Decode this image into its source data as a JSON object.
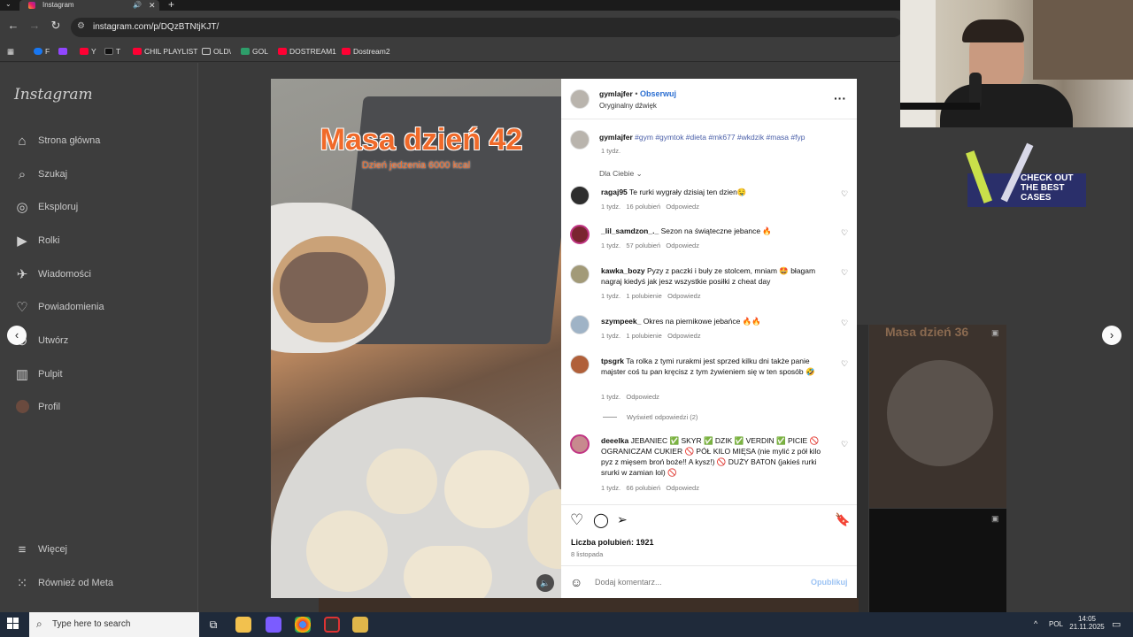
{
  "browser": {
    "tab_title": "Instagram",
    "url": "instagram.com/p/DQzBTNtjKJT/",
    "bookmarks": [
      "F",
      "",
      "Y",
      "T",
      "CHIL PLAYLIST",
      "OLD\\",
      "GOL",
      "DOSTREAM1",
      "Dostream2"
    ]
  },
  "sidebar": {
    "logo": "Instagram",
    "items": [
      {
        "label": "Strona główna",
        "icon": "home-icon"
      },
      {
        "label": "Szukaj",
        "icon": "search-icon"
      },
      {
        "label": "Eksploruj",
        "icon": "explore-compass-icon"
      },
      {
        "label": "Rolki",
        "icon": "reels-icon"
      },
      {
        "label": "Wiadomości",
        "icon": "messages-icon"
      },
      {
        "label": "Powiadomienia",
        "icon": "heart-icon"
      },
      {
        "label": "Utwórz",
        "icon": "plus-icon"
      },
      {
        "label": "Pulpit",
        "icon": "dashboard-icon"
      },
      {
        "label": "Profil",
        "icon": "profile-avatar-icon"
      }
    ],
    "more": "Więcej",
    "meta": "Również od Meta"
  },
  "post": {
    "overlay_title": "Masa dzień 42",
    "overlay_subtitle": "Dzień jedzenia 6000 kcal",
    "author": "gymlajfer",
    "follow": "Obserwuj",
    "audio": "Oryginalny dźwięk",
    "caption_user": "gymlajfer",
    "caption_tags": "#gym #gymtok #dieta #mk677 #wkdzik #masa #fyp",
    "caption_time": "1 tydz.",
    "filter": "Dla Ciebie",
    "likes": "Liczba polubień: 1921",
    "date": "8 listopada",
    "comment_placeholder": "Dodaj komentarz...",
    "publish": "Opublikuj",
    "grid_text": "Masa dzień 36"
  },
  "comments": [
    {
      "user": "ragaj95",
      "text": "Te rurki wygrały dzisiaj ten dzien🤤",
      "time": "1 tydz.",
      "likes": "16 polubień",
      "reply": "Odpowiedz"
    },
    {
      "user": "_lil_samdzon_._",
      "text": "Sezon na świąteczne jebance 🔥",
      "time": "1 tydz.",
      "likes": "57 polubień",
      "reply": "Odpowiedz"
    },
    {
      "user": "kawka_bozy",
      "text": "Pyzy z paczki i buły ze stolcem, mniam 🤩 błagam nagraj kiedyś jak jesz wszystkie posiłki z cheat day",
      "time": "1 tydz.",
      "likes": "1 polubienie",
      "reply": "Odpowiedz"
    },
    {
      "user": "szympeek_",
      "text": "Okres na piernikowe jebańce 🔥🔥",
      "time": "1 tydz.",
      "likes": "1 polubienie",
      "reply": "Odpowiedz"
    },
    {
      "user": "tpsgrk",
      "text": "Ta rolka z tymi rurakmi jest sprzed kilku dni także panie majster coś tu pan kręcisz z tym żywieniem się w ten sposób 🤣",
      "time": "1 tydz.",
      "likes": "",
      "reply": "Odpowiedz",
      "view_replies": "Wyświetl odpowiedzi (2)"
    },
    {
      "user": "deeelka",
      "text": "JEBANIEC ✅ SKYR ✅ DZIK ✅ VERDIN ✅ PICIE 🚫 OGRANICZAM CUKIER 🚫 PÓŁ KILO MIĘSA (nie mylić z pół kilo pyz z mięsem broń boże!! A kysz!) 🚫 DUŻY BATON (jakieś rurki srurki w zamian lol) 🚫",
      "time": "1 tydz.",
      "likes": "66 polubień",
      "reply": "Odpowiedz"
    }
  ],
  "overlay_ad": {
    "text": "CHECK OUT THE BEST CASES"
  },
  "taskbar": {
    "search_placeholder": "Type here to search",
    "lang": "POL",
    "time": "14:05",
    "date": "21.11.2025"
  }
}
